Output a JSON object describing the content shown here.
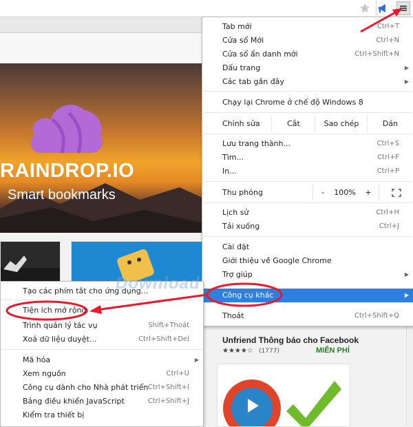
{
  "toolbar": {
    "star_icon": "star-icon",
    "ext_icon": "megaphone-icon",
    "menu_icon": "hamburger-menu-icon"
  },
  "hero": {
    "title": "RAINDROP.IO",
    "subtitle": "Smart bookmarks",
    "title_visible": "RAINDROP.IO"
  },
  "store": {
    "ext_title": "Unfriend Thông báo cho Facebook",
    "stars": "★★★★☆",
    "count": "(1777)",
    "price": "MIỄN PHÍ"
  },
  "main_menu": {
    "items": [
      {
        "label": "Tab mới",
        "shortcut": "Ctrl+T"
      },
      {
        "label": "Cửa sổ Mới",
        "shortcut": "Ctrl+N"
      },
      {
        "label": "Cửa sổ ẩn danh mới",
        "shortcut": "Ctrl+Shift+N"
      },
      {
        "label": "Dấu trang",
        "shortcut": ""
      },
      {
        "label": "Các tab gần đây",
        "shortcut": ""
      },
      {
        "label": "Chạy lại Chrome ở chế độ Windows 8",
        "shortcut": ""
      },
      {
        "label": "Lưu trang thành...",
        "shortcut": "Ctrl+S"
      },
      {
        "label": "Tìm...",
        "shortcut": "Ctrl+F"
      },
      {
        "label": "In...",
        "shortcut": "Ctrl+P"
      },
      {
        "label": "Lịch sử",
        "shortcut": "Ctrl+H"
      },
      {
        "label": "Tải xuống",
        "shortcut": "Ctrl+J"
      },
      {
        "label": "Cài đặt",
        "shortcut": ""
      },
      {
        "label": "Giới thiệu về Google Chrome",
        "shortcut": ""
      },
      {
        "label": "Trợ giúp",
        "shortcut": ""
      },
      {
        "label": "Công cụ khác",
        "shortcut": ""
      },
      {
        "label": "Thoát",
        "shortcut": "Ctrl+Shift+Q"
      }
    ],
    "edit": {
      "label": "Chỉnh sửa",
      "cut": "Cắt",
      "copy": "Sao chép",
      "paste": "Dán"
    },
    "zoom": {
      "label": "Thu phóng",
      "minus": "-",
      "value": "100%",
      "plus": "+"
    }
  },
  "sub_menu": {
    "items": [
      {
        "label": "Tạo các phím tắt cho ứng dụng...",
        "shortcut": ""
      },
      {
        "label": "Tiện ích mở rộng",
        "shortcut": ""
      },
      {
        "label": "Trình quản lý tác vụ",
        "shortcut": "Shift+Thoát"
      },
      {
        "label": "Xoá dữ liệu duyệt...",
        "shortcut": "Ctrl+Shift+Del"
      },
      {
        "label": "Mã hóa",
        "shortcut": ""
      },
      {
        "label": "Xem nguồn",
        "shortcut": "Ctrl+U"
      },
      {
        "label": "Công cụ dành cho Nhà phát triển",
        "shortcut": "Ctrl+Shift+I"
      },
      {
        "label": "Bảng điều khiển JavaScript",
        "shortcut": "Ctrl+Shift+J"
      },
      {
        "label": "Kiểm tra thiết bị",
        "shortcut": ""
      }
    ]
  },
  "watermark": "Download",
  "colors": {
    "highlight": "#2f7fe0",
    "annotation": "#e8192c",
    "free": "#2b7a2b"
  }
}
